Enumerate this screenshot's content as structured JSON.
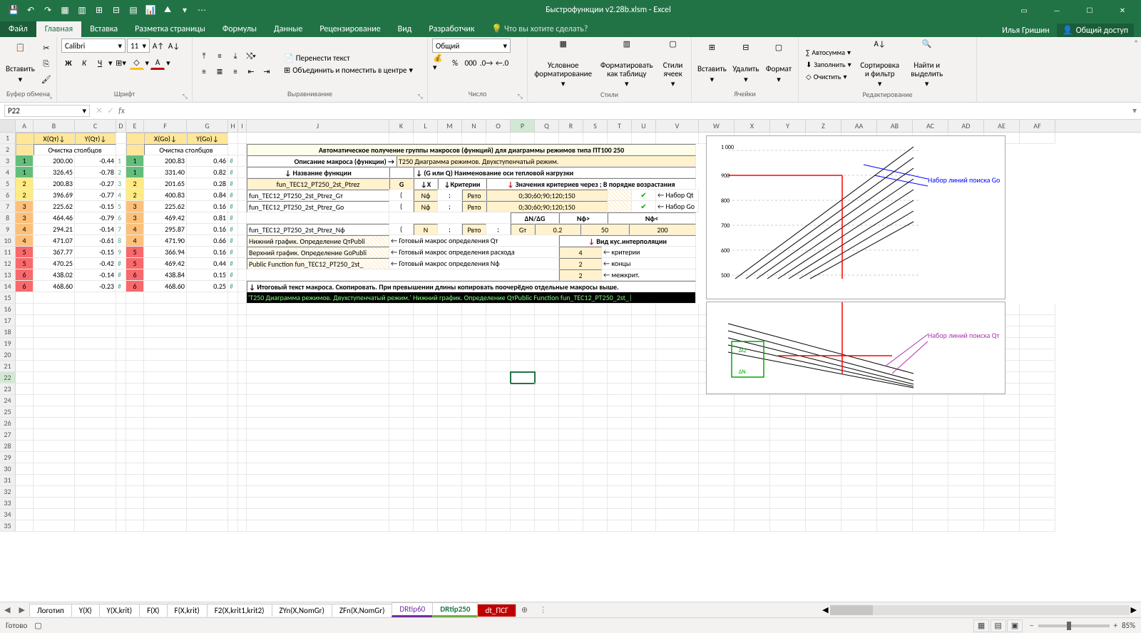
{
  "title": "Быстрофункции v2.28b.xlsm - Excel",
  "qat": [
    "save-icon",
    "undo-icon",
    "redo-icon",
    "q1",
    "q2",
    "q3",
    "q4",
    "q5",
    "q6",
    "chart-icon",
    "q7",
    "q8"
  ],
  "tabs": {
    "file": "Файл",
    "home": "Главная",
    "insert": "Вставка",
    "layout": "Разметка страницы",
    "formulas": "Формулы",
    "data": "Данные",
    "review": "Рецензирование",
    "view": "Вид",
    "developer": "Разработчик",
    "tell": "Что вы хотите сделать?"
  },
  "user": "Илья Гришин",
  "share": "Общий доступ",
  "ribbon": {
    "paste": "Вставить",
    "clipboard": "Буфер обмена",
    "fontName": "Calibri",
    "fontSize": "11",
    "fontGroup": "Шрифт",
    "wrap": "Перенести текст",
    "merge": "Объединить и поместить в центре",
    "align": "Выравнивание",
    "numFmt": "Общий",
    "number": "Число",
    "cond": "Условное форматирование",
    "fmtTable": "Форматировать как таблицу",
    "cellStyles": "Стили ячеек",
    "styles": "Стили",
    "ins": "Вставить",
    "del": "Удалить",
    "fmt": "Формат",
    "cells": "Ячейки",
    "autosum": "Автосумма",
    "fill": "Заполнить",
    "clear": "Очистить",
    "sort": "Сортировка и фильтр",
    "find": "Найти и выделить",
    "editing": "Редактирование"
  },
  "nameBox": "P22",
  "cols": [
    "A",
    "B",
    "C",
    "D",
    "E",
    "F",
    "G",
    "H",
    "I",
    "J",
    "K",
    "L",
    "M",
    "N",
    "O",
    "P",
    "Q",
    "R",
    "S",
    "T",
    "U",
    "V",
    "W",
    "X",
    "Y",
    "Z",
    "AA",
    "AB",
    "AC",
    "AD",
    "AE",
    "AF"
  ],
  "left": {
    "h1a": "X(Qт)↓",
    "h1b": "Y(Qт)↓",
    "h1c": "X(Go)↓",
    "h1d": "Y(Go)↓",
    "clear": "Очистка столбцов",
    "qt": [
      {
        "n": "1",
        "x": "200.00",
        "y": "-0.44"
      },
      {
        "n": "1",
        "x": "326.45",
        "y": "-0.78"
      },
      {
        "n": "2",
        "x": "200.83",
        "y": "-0.27"
      },
      {
        "n": "2",
        "x": "396.69",
        "y": "-0.77"
      },
      {
        "n": "3",
        "x": "225.62",
        "y": "-0.15"
      },
      {
        "n": "3",
        "x": "464.46",
        "y": "-0.79"
      },
      {
        "n": "4",
        "x": "294.21",
        "y": "-0.14"
      },
      {
        "n": "4",
        "x": "471.07",
        "y": "-0.61"
      },
      {
        "n": "5",
        "x": "367.77",
        "y": "-0.15"
      },
      {
        "n": "5",
        "x": "470.25",
        "y": "-0.42"
      },
      {
        "n": "6",
        "x": "438.02",
        "y": "-0.14"
      },
      {
        "n": "6",
        "x": "468.60",
        "y": "-0.23"
      }
    ],
    "go": [
      {
        "n": "1",
        "x": "200.83",
        "y": "0.46"
      },
      {
        "n": "1",
        "x": "331.40",
        "y": "0.82"
      },
      {
        "n": "2",
        "x": "201.65",
        "y": "0.28"
      },
      {
        "n": "2",
        "x": "400.83",
        "y": "0.84"
      },
      {
        "n": "3",
        "x": "225.62",
        "y": "0.16"
      },
      {
        "n": "3",
        "x": "469.42",
        "y": "0.81"
      },
      {
        "n": "4",
        "x": "295.87",
        "y": "0.16"
      },
      {
        "n": "4",
        "x": "471.90",
        "y": "0.66"
      },
      {
        "n": "5",
        "x": "366.94",
        "y": "0.16"
      },
      {
        "n": "5",
        "x": "469.42",
        "y": "0.44"
      },
      {
        "n": "6",
        "x": "438.84",
        "y": "0.15"
      },
      {
        "n": "6",
        "x": "468.60",
        "y": "0.25"
      }
    ]
  },
  "mid": {
    "title": "Автоматическое получение группы макросов (функций) для диаграммы режимов типа ПТ100 250",
    "descLabel": "Описание макроса (функции) →",
    "desc": "Т250 Диаграмма режимов. Двухступенчатый режим.",
    "nameLabel": "↓ Название функции",
    "axisLabel": "↓ (G или Q) Наименование оси тепловой нагрузки",
    "fnBase": "fun_TEC12_PT250_2st_Ptrez",
    "G": "G",
    "x": "↓X",
    "crit": "↓Критерии",
    "critVals": "↓ Значения критериев через ; В порядке возрастания",
    "r1": {
      "fn": "fun_TEC12_PT250_2st_Ptrez_Gт",
      "l": "(",
      "a": "Nф",
      "s": ";",
      "b": "Рвто",
      "vals": "0;30;60;90;120;150",
      "note": "← Набор Qt"
    },
    "r2": {
      "fn": "fun_TEC12_PT250_2st_Ptrez_Go",
      "l": "(",
      "a": "Nф",
      "s": ";",
      "b": "Рвто",
      "vals": "0;30;60;90;120;150",
      "note": "← Набор Go"
    },
    "dnDg": "ΔN/ΔG",
    "ngt": "Nф>",
    "nlt": "Nф<",
    "r3": {
      "fn": "fun_TEC12_PT250_2st_Ptrez_Nф",
      "l": "(",
      "a": "N",
      "s": ";",
      "b": "Рвто",
      "s2": ";",
      "c": "Gт",
      "v1": "0.2",
      "v2": "50",
      "v3": "200"
    },
    "g1": "Нижний график. Определение  QтPubli",
    "g1r": "← Готовый макрос   определения Qт",
    "interp": "↓ Вид кус.интерполяции",
    "g2": "Верхний график. Определение GoPubli",
    "g2r": "← Готовый макрос   определения расхода",
    "c1": "4",
    "c1r": "←  критерии",
    "g3": "Public Function fun_TEC12_PT250_2st_",
    "g3r": "← Готовый макрос   определения Nф",
    "c2": "2",
    "c2r": "←  концы",
    "c3": "2",
    "c3r": "←  межкрит.",
    "finalLabel": "↓  Итоговый текст макроса. Скопировать. При превышении длины копировать поочерёдно отдельные макросы выше.",
    "finalRow": "'Т250 Диаграмма режимов. Двухступенчатый режим.' Нижний график. Определение  QтPublic Function fun_TEC12_PT250_2st_|"
  },
  "chartNotes": {
    "a": "Набор линий поиска Go",
    "b": "Набор линий поиска Qт"
  },
  "sheets": [
    "Логотип",
    "Y(X)",
    "Y(X,krit)",
    "F(X)",
    "F(X,krit)",
    "F2(X,krit1,krit2)",
    "ZYn(X,NomGr)",
    "ZFn(X,NomGr)",
    "DRtip60",
    "DRtip250",
    "dt_ПСГ"
  ],
  "activeSheet": "DRtip250",
  "status": {
    "ready": "Готово",
    "zoom": "85%"
  }
}
